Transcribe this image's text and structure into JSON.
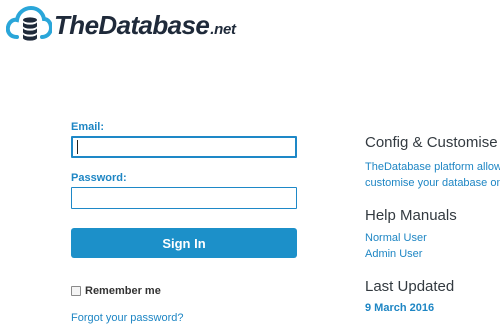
{
  "brand": {
    "name": "TheDatabase",
    "suffix": ".net",
    "logo_icon": "cloud-database-icon",
    "colors": {
      "cloud": "#2aa6d9",
      "database": "#1f2a3a"
    }
  },
  "login": {
    "email_label": "Email:",
    "email_value": "",
    "password_label": "Password:",
    "password_value": "",
    "sign_in_label": "Sign In",
    "remember_label": "Remember me",
    "remember_checked": false,
    "forgot_label": "Forgot your password?"
  },
  "sidebar": {
    "config_heading": "Config & Customise",
    "config_text_1": "TheDatabase platform allows you to",
    "config_text_2": "customise your database online",
    "manuals_heading": "Help Manuals",
    "manual_links": [
      "Normal User",
      "Admin User"
    ],
    "updated_heading": "Last Updated",
    "updated_date": "9 March 2016"
  },
  "theme": {
    "accent": "#1c90c9",
    "link": "#1e86c4",
    "text": "#333333"
  }
}
